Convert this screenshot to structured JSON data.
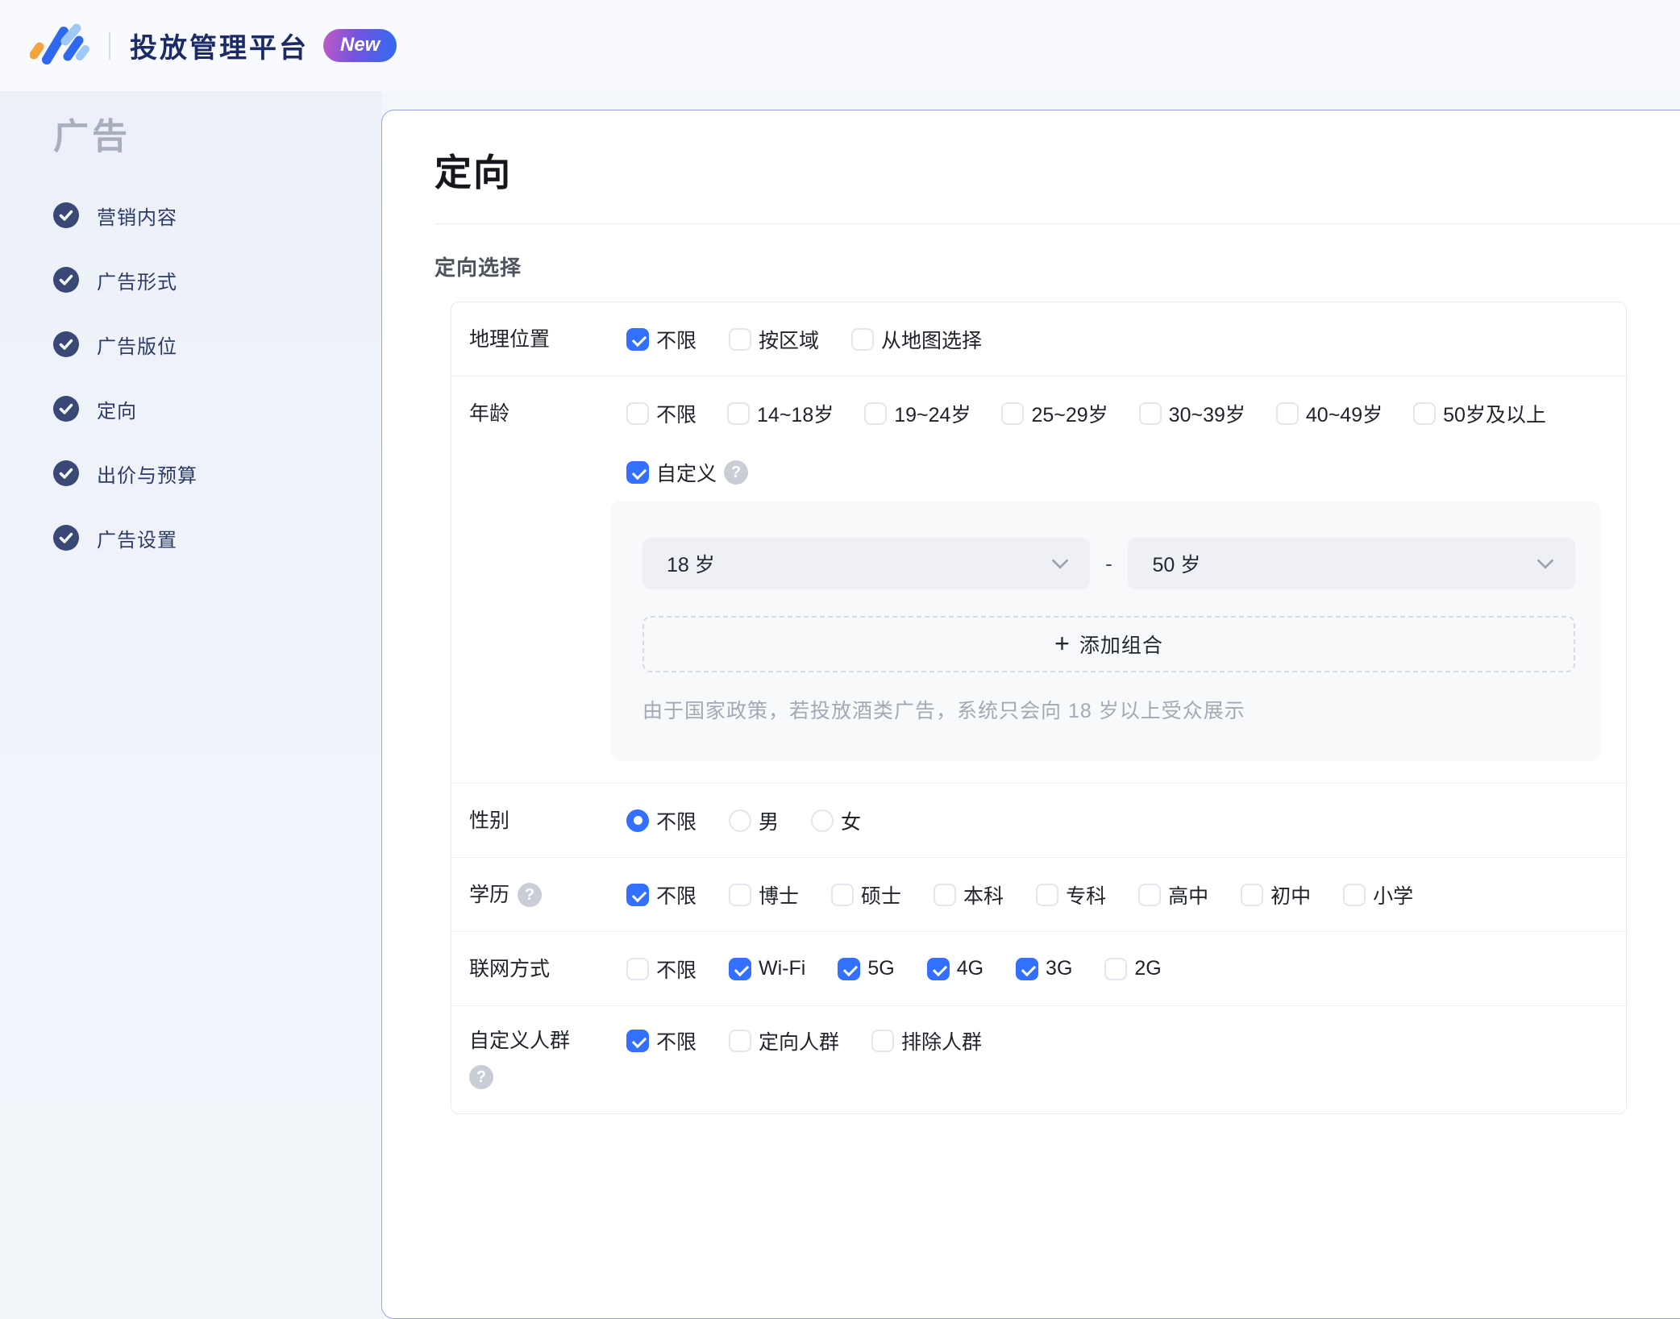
{
  "header": {
    "title": "投放管理平台",
    "badge": "New",
    "logo_icon": "slanted-bars-logo",
    "colors": {
      "accent_blue": "#3370FF",
      "brand_navy": "#1C2B66",
      "logo_orange": "#F5A43C",
      "logo_blue": "#2E68EC",
      "logo_light_blue": "#9FC8F7",
      "badge_gradient": [
        "#C35BC4",
        "#7254DF",
        "#2F6BF2"
      ]
    }
  },
  "sidebar": {
    "heading": "广告",
    "items": [
      {
        "label": "营销内容",
        "status": "completed",
        "icon": "check-circle"
      },
      {
        "label": "广告形式",
        "status": "completed",
        "icon": "check-circle"
      },
      {
        "label": "广告版位",
        "status": "completed",
        "icon": "check-circle"
      },
      {
        "label": "定向",
        "status": "completed",
        "icon": "check-circle"
      },
      {
        "label": "出价与预算",
        "status": "completed",
        "icon": "check-circle"
      },
      {
        "label": "广告设置",
        "status": "completed",
        "icon": "check-circle"
      }
    ]
  },
  "main": {
    "title": "定向",
    "section_label": "定向选择",
    "rows": {
      "geo": {
        "label": "地理位置",
        "options": [
          {
            "label": "不限",
            "checked": true
          },
          {
            "label": "按区域",
            "checked": false
          },
          {
            "label": "从地图选择",
            "checked": false
          }
        ]
      },
      "age": {
        "label": "年龄",
        "options": [
          {
            "label": "不限",
            "checked": false
          },
          {
            "label": "14~18岁",
            "checked": false
          },
          {
            "label": "19~24岁",
            "checked": false
          },
          {
            "label": "25~29岁",
            "checked": false
          },
          {
            "label": "30~39岁",
            "checked": false
          },
          {
            "label": "40~49岁",
            "checked": false
          },
          {
            "label": "50岁及以上",
            "checked": false
          }
        ],
        "custom_option": {
          "label": "自定义",
          "checked": true,
          "help_icon": "question-circle"
        },
        "panel": {
          "from_value": "18 岁",
          "separator": "-",
          "to_value": "50 岁",
          "add_button": {
            "plus": "+",
            "label": "添加组合"
          },
          "note": "由于国家政策，若投放酒类广告，系统只会向 18 岁以上受众展示"
        }
      },
      "gender": {
        "label": "性别",
        "type": "radio",
        "options": [
          {
            "label": "不限",
            "checked": true
          },
          {
            "label": "男",
            "checked": false
          },
          {
            "label": "女",
            "checked": false
          }
        ]
      },
      "education": {
        "label": "学历",
        "help_icon": "question-circle",
        "options": [
          {
            "label": "不限",
            "checked": true
          },
          {
            "label": "博士",
            "checked": false
          },
          {
            "label": "硕士",
            "checked": false
          },
          {
            "label": "本科",
            "checked": false
          },
          {
            "label": "专科",
            "checked": false
          },
          {
            "label": "高中",
            "checked": false
          },
          {
            "label": "初中",
            "checked": false
          },
          {
            "label": "小学",
            "checked": false
          }
        ]
      },
      "network": {
        "label": "联网方式",
        "options": [
          {
            "label": "不限",
            "checked": false
          },
          {
            "label": "Wi-Fi",
            "checked": true
          },
          {
            "label": "5G",
            "checked": true
          },
          {
            "label": "4G",
            "checked": true
          },
          {
            "label": "3G",
            "checked": true
          },
          {
            "label": "2G",
            "checked": false
          }
        ]
      },
      "custom_audience": {
        "label": "自定义人群",
        "help_icon": "question-circle",
        "options": [
          {
            "label": "不限",
            "checked": true
          },
          {
            "label": "定向人群",
            "checked": false
          },
          {
            "label": "排除人群",
            "checked": false
          }
        ]
      }
    }
  },
  "icons": {
    "help_glyph": "?"
  }
}
